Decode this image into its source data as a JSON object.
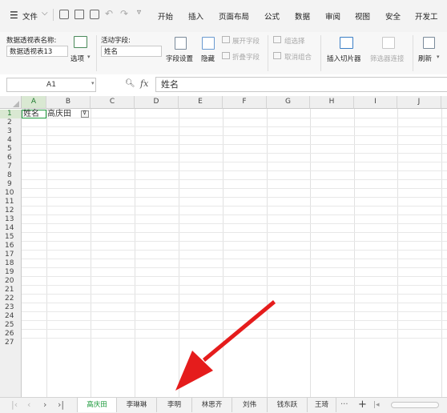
{
  "menubar": {
    "file_label": "文件",
    "tabs": [
      "开始",
      "插入",
      "页面布局",
      "公式",
      "数据",
      "审阅",
      "视图",
      "安全",
      "开发工"
    ]
  },
  "ribbon": {
    "pivot_name_label": "数据透视表名称:",
    "pivot_name_value": "数据透视表13",
    "options_label": "选项",
    "active_field_label": "活动字段:",
    "active_field_value": "姓名",
    "field_settings_label": "字段设置",
    "hide_label": "隐藏",
    "expand_field_label": "展开字段",
    "collapse_field_label": "折叠字段",
    "group_select_label": "组选择",
    "ungroup_label": "取消组合",
    "insert_slicer_label": "插入切片器",
    "filter_connections_label": "筛选器连接",
    "refresh_label": "刷新"
  },
  "formula_bar": {
    "cell_ref": "A1",
    "fx": "fx",
    "content": "姓名"
  },
  "grid": {
    "columns": [
      "A",
      "B",
      "C",
      "D",
      "E",
      "F",
      "G",
      "H",
      "I",
      "J"
    ],
    "rows": [
      "1",
      "2",
      "3",
      "4",
      "5",
      "6",
      "7",
      "8",
      "9",
      "10",
      "11",
      "12",
      "13",
      "14",
      "15",
      "16",
      "17",
      "18",
      "19",
      "20",
      "21",
      "22",
      "23",
      "24",
      "25",
      "26",
      "27"
    ],
    "a1": "姓名",
    "b1": "高庆田"
  },
  "sheets": {
    "tabs": [
      "高庆田",
      "李琳琳",
      "李明",
      "林思齐",
      "刘伟",
      "钱东跃",
      "王琦"
    ],
    "active": "高庆田",
    "more": "···",
    "add": "+"
  },
  "colors": {
    "active_tab": "#1e9a3c",
    "arrow": "#e51c1c",
    "selection": "#1e9a3c"
  }
}
